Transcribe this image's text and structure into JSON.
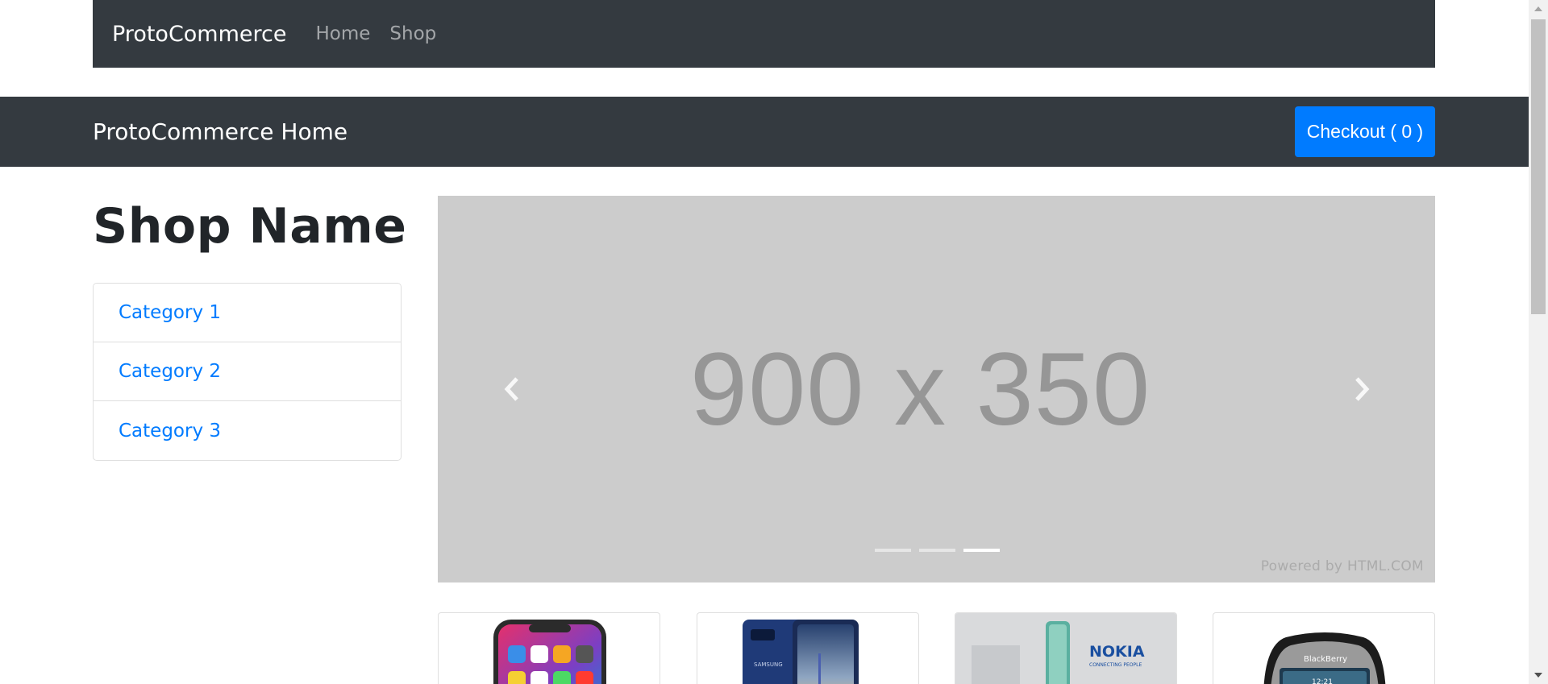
{
  "navbar": {
    "brand": "ProtoCommerce",
    "links": [
      "Home",
      "Shop"
    ]
  },
  "header": {
    "title": "ProtoCommerce Home",
    "checkout_label": "Checkout ( 0 )"
  },
  "sidebar": {
    "shop_name": "Shop Name",
    "categories": [
      "Category 1",
      "Category 2",
      "Category 3"
    ]
  },
  "carousel": {
    "placeholder_text": "900 x 350",
    "powered_by": "Powered by HTML.COM",
    "slide_count": 3,
    "active_slide": 3
  },
  "products": [
    {
      "image": "iphone-x-phone"
    },
    {
      "image": "samsung-note-8-phone"
    },
    {
      "image": "nokia-edge-phone"
    },
    {
      "image": "blackberry-phone"
    }
  ],
  "colors": {
    "navbar_bg": "#343a40",
    "accent": "#007bff",
    "carousel_bg": "#cccccc"
  }
}
